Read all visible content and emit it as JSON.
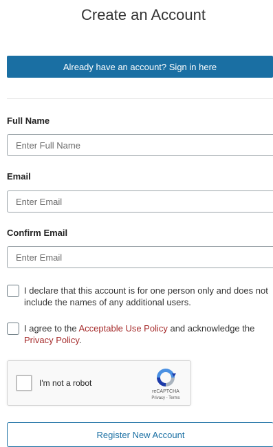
{
  "page": {
    "title": "Create an Account"
  },
  "signin": {
    "label": "Already have an account? Sign in here"
  },
  "form": {
    "full_name": {
      "label": "Full Name",
      "placeholder": "Enter Full Name",
      "value": ""
    },
    "email": {
      "label": "Email",
      "placeholder": "Enter Email",
      "value": ""
    },
    "confirm_email": {
      "label": "Confirm Email",
      "placeholder": "Enter Email",
      "value": ""
    },
    "declare": {
      "text": "I declare that this account is for one person only and does not include the names of any additional users.",
      "checked": false
    },
    "agree": {
      "prefix": "I agree to the ",
      "aup_link": "Acceptable Use Policy",
      "middle": " and acknowledge the ",
      "privacy_link": "Privacy Policy",
      "suffix": ".",
      "checked": false
    }
  },
  "recaptcha": {
    "label": "I'm not a robot",
    "brand": "reCAPTCHA",
    "terms": "Privacy - Terms",
    "checked": false
  },
  "register": {
    "label": "Register New Account"
  },
  "colors": {
    "primary": "#1a6fa3",
    "link": "#a52a2a"
  }
}
